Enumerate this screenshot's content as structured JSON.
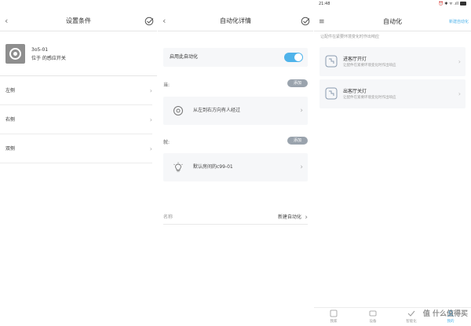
{
  "panel1": {
    "title": "设置条件",
    "device": {
      "name": "3o5-01",
      "location": "位于 的感应开关"
    },
    "rows": [
      {
        "label": "左侧"
      },
      {
        "label": "右侧"
      },
      {
        "label": "双侧"
      }
    ]
  },
  "panel2": {
    "title": "自动化详情",
    "enable_label": "启用此自动化",
    "enabled": true,
    "when_label": "当:",
    "then_label": "就:",
    "add_label": "添加",
    "condition": "从左到右方向有人经过",
    "action": "默认房间的c99-01",
    "name_label": "名称",
    "name_value": "新建自动化"
  },
  "panel3": {
    "status_time": "21:48",
    "status_icons": "⏰ ✱ ᯤ .ıll",
    "title": "自动化",
    "new_label": "新建自动化",
    "hint": "让配件在紧要环境变化时作出响应",
    "cards": [
      {
        "name": "进客厅开灯",
        "desc": "让配件在紧要环境变化时作出响应"
      },
      {
        "name": "出客厅关灯",
        "desc": "让配件在紧要环境变化时作出响应"
      }
    ],
    "tabs": [
      {
        "label": "我家"
      },
      {
        "label": "设备"
      },
      {
        "label": "智能化"
      },
      {
        "label": "我的"
      }
    ],
    "accent_color": "#4fb3ea"
  },
  "watermark": "值 什么值得买"
}
